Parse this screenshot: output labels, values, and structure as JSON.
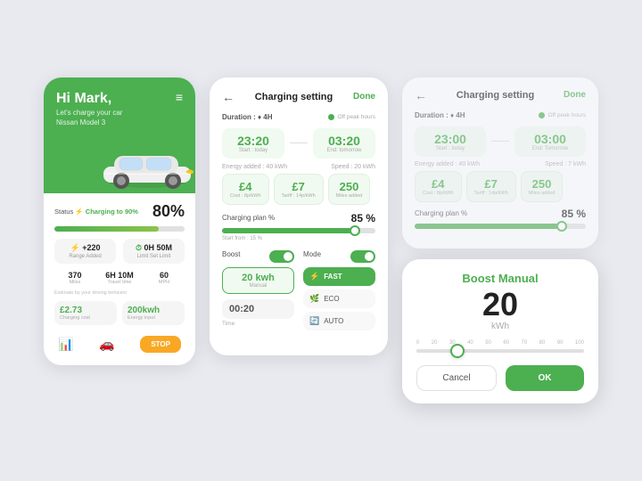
{
  "left": {
    "greeting": "Hi Mark,",
    "sub1": "Let's charge your car",
    "sub2": "Nissan Model 3",
    "menu_icon": "≡",
    "status_label": "Status",
    "status_charging": "⚡ Charging to 90%",
    "status_pct": "80%",
    "range_added_val": "+220",
    "range_added_icon": "⚡",
    "range_added_lbl": "Range Added",
    "limit_val": "0H 50M",
    "limit_icon": "⏱",
    "limit_lbl": "Limit Set Limit",
    "miles_val": "370",
    "miles_lbl": "Miles",
    "travel_val": "6H 10M",
    "travel_lbl": "Travel time",
    "mph_val": "60",
    "mph_lbl": "MPH",
    "estimate_text": "Estimate by your driving behavior",
    "cost_val": "£2.73",
    "cost_lbl": "Charging cost",
    "energy_val": "200kwh",
    "energy_lbl": "Energy input",
    "stop_label": "STOP"
  },
  "mid": {
    "back_arrow": "←",
    "title": "Charging setting",
    "done": "Done",
    "duration_prefix": "Duration : ",
    "duration_val": "♦ 4H",
    "offpeak": "Off peak hours",
    "start_time": "23:20",
    "start_lbl": "Start : today",
    "dash": "——",
    "end_time": "03:20",
    "end_lbl": "End: tomorrow",
    "energy_added_lbl": "Energy added : 40 kWh",
    "speed_lbl": "Speed : 20 kWh",
    "cost_val": "£4",
    "cost_sub": "Cost : 8p/kWh",
    "tariff_val": "£7",
    "tariff_sub": "Tariff : 14p/kWh",
    "miles_val": "250",
    "miles_sub": "Miles added",
    "charging_plan_lbl": "Charging plan %",
    "charging_plan_pct": "85 %",
    "slider_start": "Start from : 15 %",
    "boost_label": "Boost",
    "mode_label": "Mode",
    "boost_kwh_val": "20 kwh",
    "boost_kwh_lbl": "Manual",
    "time_val": "00:20",
    "time_lbl": "Time",
    "fast_label": "FAST",
    "eco_label": "ECO",
    "auto_label": "AUTO"
  },
  "right_top": {
    "back_arrow": "←",
    "title": "Charging setting",
    "done": "Done",
    "duration_prefix": "Duration : ",
    "duration_val": "♦ 4H",
    "offpeak": "Off peak hours",
    "start_time": "23:00",
    "start_lbl": "Start : today",
    "end_time": "03:00",
    "end_lbl": "End: Tomorrow",
    "energy_lbl": "Energy added : 40 kWh",
    "speed_lbl": "Speed : 7 kWh",
    "cost_val": "£4",
    "cost_sub": "Cost : 8p/kWh",
    "tariff_val": "£7",
    "tariff_sub": "Tariff : 14p/kWh",
    "miles_val": "250",
    "miles_sub": "Miles added",
    "charging_plan_lbl": "Charging plan %",
    "charging_plan_pct": "85 %"
  },
  "boost_modal": {
    "title_prefix": "Boost",
    "title_suffix": "Manual",
    "value": "20",
    "unit": "kWh",
    "scale_labels": [
      "0",
      "20",
      "30",
      "40",
      "50",
      "60",
      "70",
      "80",
      "90",
      "100"
    ],
    "cancel_label": "Cancel",
    "ok_label": "OK"
  },
  "colors": {
    "green": "#4CAF50",
    "yellow": "#F9A825",
    "light_green_bg": "#f0faf0"
  }
}
